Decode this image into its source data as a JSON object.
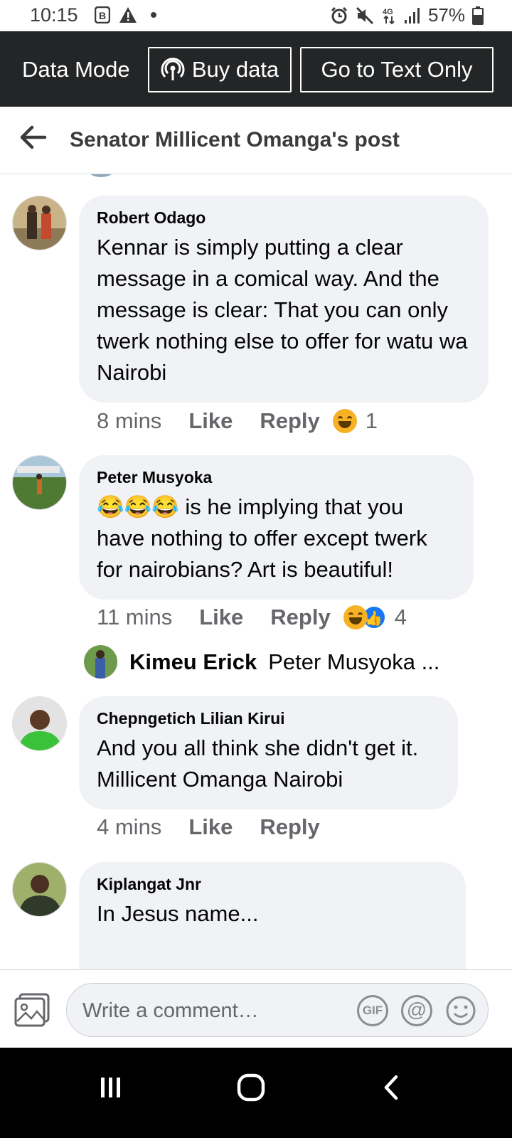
{
  "status_bar": {
    "time": "10:15",
    "battery": "57%"
  },
  "data_bar": {
    "label": "Data Mode",
    "buy_data": "Buy data",
    "text_only": "Go to Text Only"
  },
  "header": {
    "title": "Senator Millicent Omanga's post"
  },
  "comments": [
    {
      "author": "Robert Odago",
      "text": "Kennar is simply putting a clear message in a comical way. And the message is clear: That you can only twerk nothing else to offer for watu wa Nairobi",
      "time": "8 mins",
      "like": "Like",
      "reply": "Reply",
      "reaction_count": "1",
      "reaction_icons": [
        "laugh-icon"
      ]
    },
    {
      "author": "Peter Musyoka",
      "emoji": "😂😂😂",
      "text": " is he implying that you have nothing to offer except twerk for nairobians? Art is beautiful!",
      "time": "11 mins",
      "like": "Like",
      "reply": "Reply",
      "reaction_count": "4",
      "reaction_icons": [
        "laugh-icon",
        "thumbs-up-icon"
      ]
    },
    {
      "author": "Chepngetich Lilian Kirui",
      "text": "And you all think she didn't get it. Millicent Omanga Nairobi",
      "time": "4 mins",
      "like": "Like",
      "reply": "Reply"
    },
    {
      "author": "Kiplangat Jnr",
      "text": "In Jesus name..."
    }
  ],
  "reply_preview": {
    "author": "Kimeu  Erick",
    "text": "Peter Musyoka ..."
  },
  "composer": {
    "placeholder": "Write a comment…",
    "gif": "GIF",
    "at": "@"
  },
  "colors": {
    "dark_bar": "#242526",
    "bubble": "#f0f2f5",
    "meta": "#65676b",
    "like_blue": "#1877f2"
  }
}
